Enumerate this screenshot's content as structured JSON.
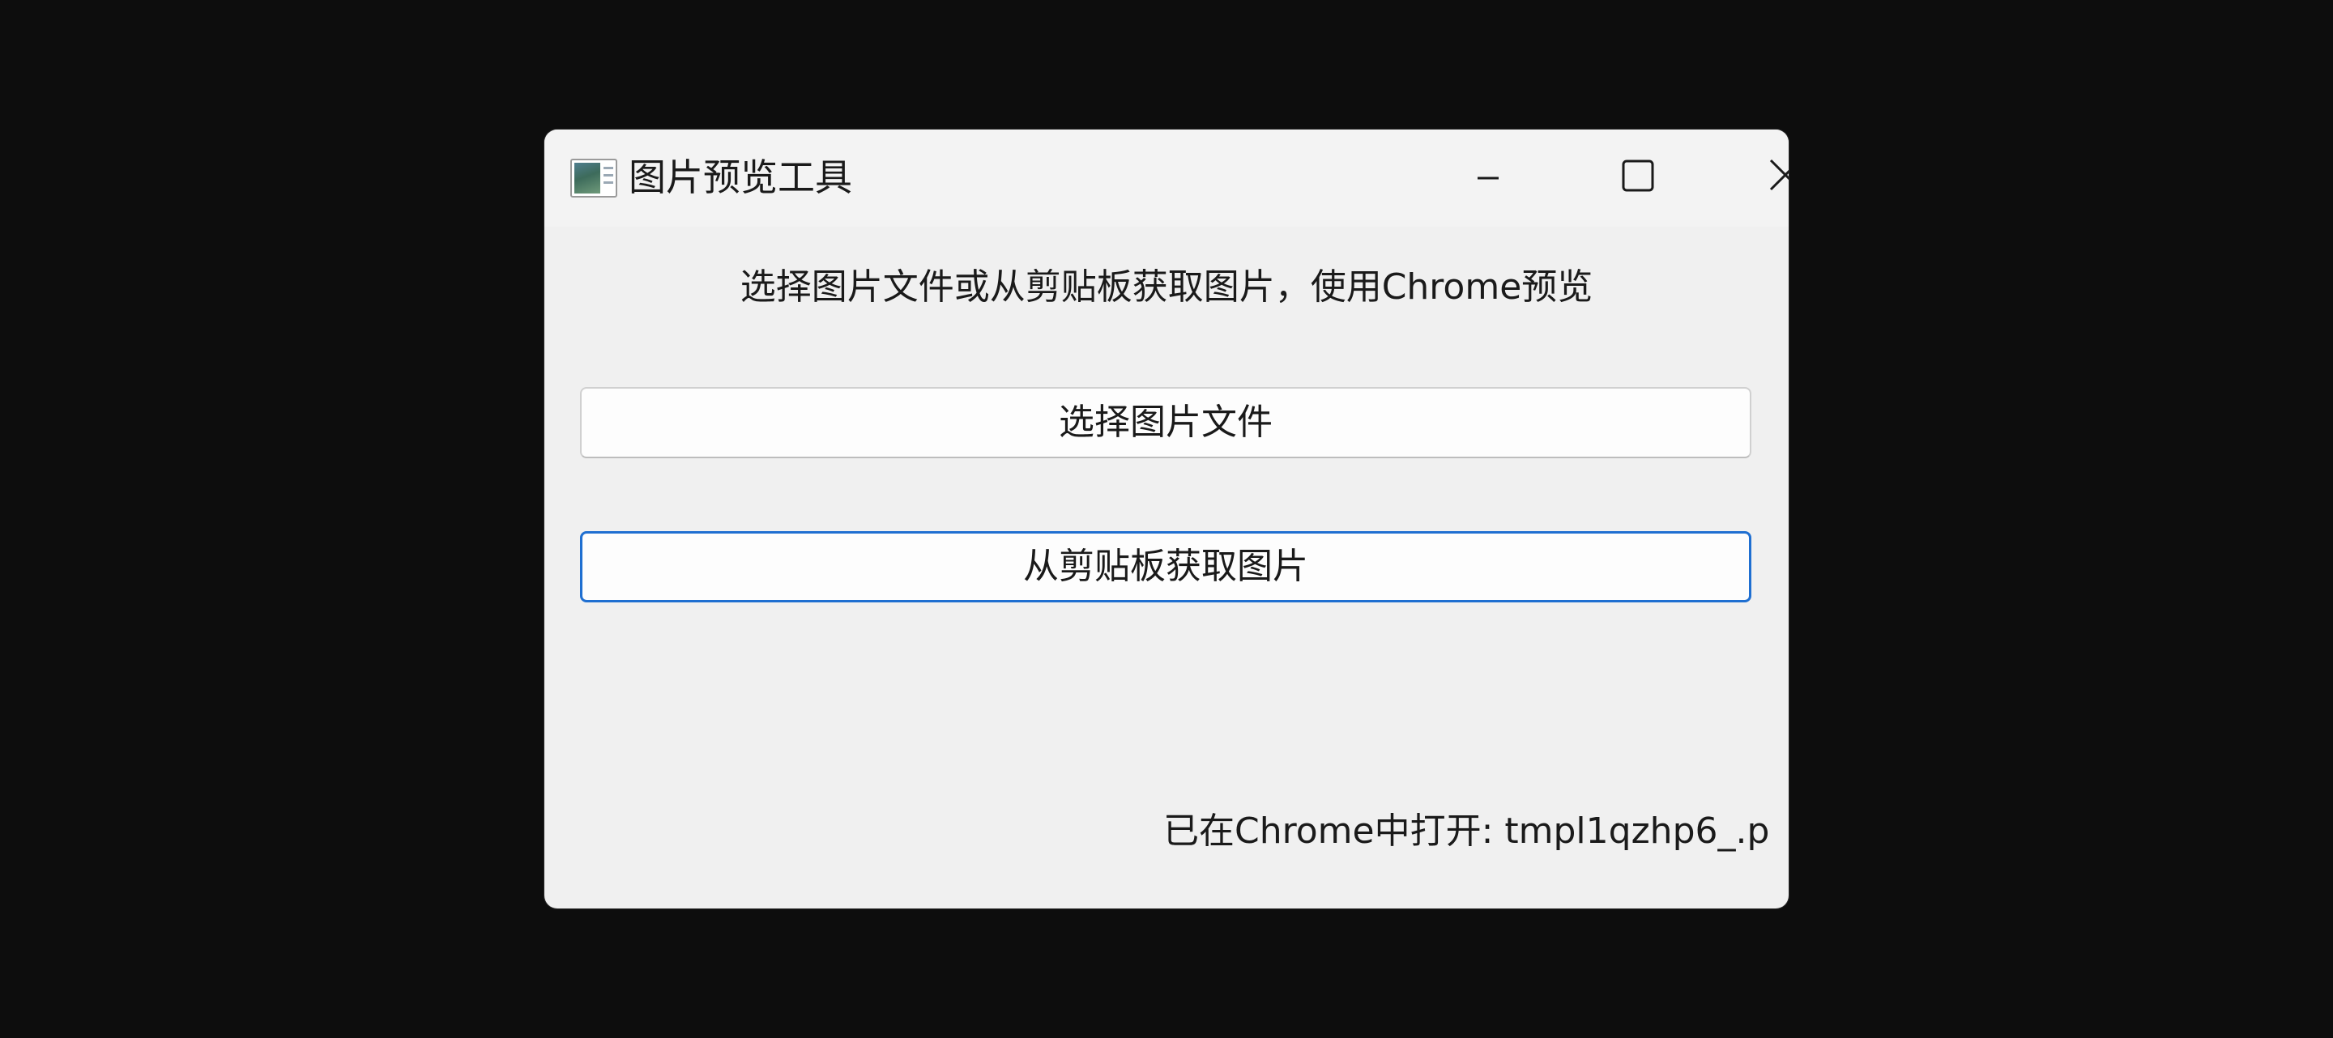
{
  "window": {
    "title": "图片预览工具",
    "icon": "image-preview-app-icon",
    "controls": {
      "minimize_icon": "minimize-icon",
      "maximize_icon": "maximize-icon",
      "close_icon": "close-icon"
    }
  },
  "main": {
    "instruction": "选择图片文件或从剪贴板获取图片，使用Chrome预览",
    "select_file_button": "选择图片文件",
    "clipboard_button": "从剪贴板获取图片",
    "status": "已在Chrome中打开: tmpl1qzhp6_.p"
  },
  "colors": {
    "background": "#0d0d0d",
    "window": "#f0f0f0",
    "focus_accent": "#1f6fd1"
  }
}
